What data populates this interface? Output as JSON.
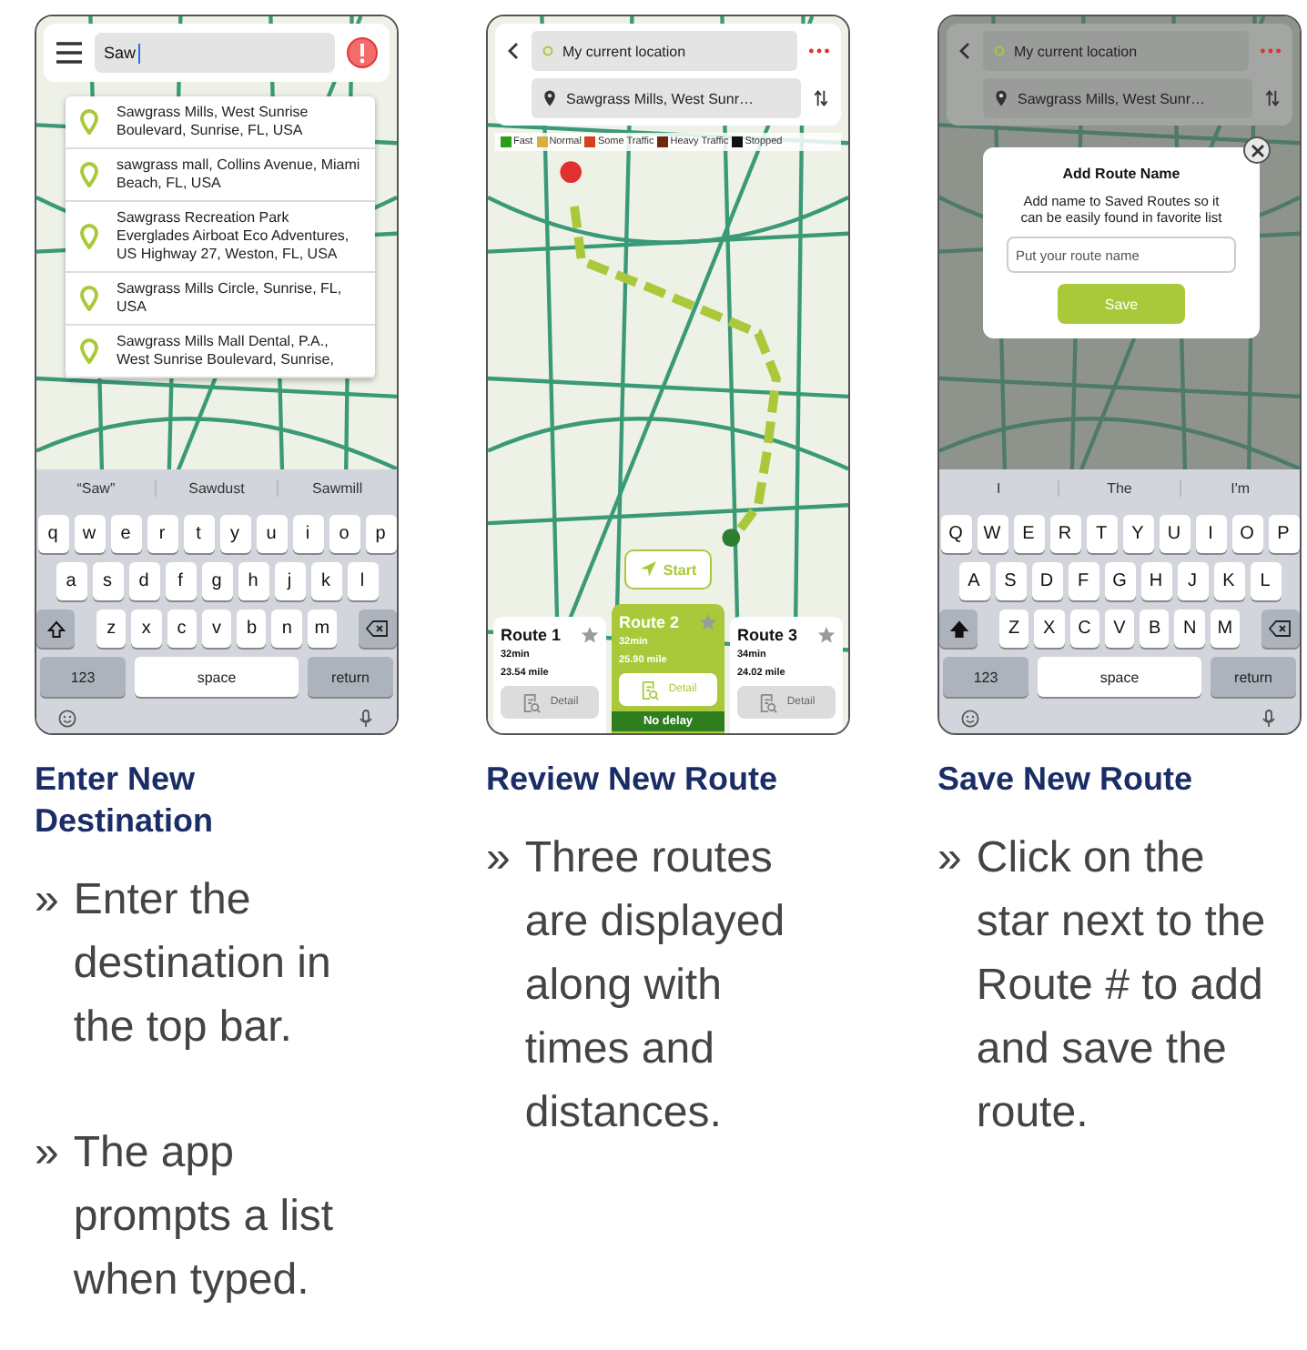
{
  "steps": [
    {
      "screen": {
        "kind": "search",
        "search": {
          "value": "Saw"
        },
        "suggestions": [
          {
            "text": "Sawgrass Mills, West Sunrise Boulevard, Sunrise, FL, USA"
          },
          {
            "text": "sawgrass mall, Collins Avenue, Miami Beach, FL, USA"
          },
          {
            "text": "Sawgrass Recreation Park Everglades Airboat Eco Adventures, US Highway 27, Weston, FL, USA"
          },
          {
            "text": "Sawgrass Mills Circle, Sunrise, FL, USA"
          },
          {
            "text": "Sawgrass Mills Mall Dental, P.A., West Sunrise Boulevard, Sunrise,"
          }
        ],
        "keyboard": {
          "suggestions": [
            "“Saw”",
            "Sawdust",
            "Sawmill"
          ],
          "rows": [
            [
              "q",
              "w",
              "e",
              "r",
              "t",
              "y",
              "u",
              "i",
              "o",
              "p"
            ],
            [
              "a",
              "s",
              "d",
              "f",
              "g",
              "h",
              "j",
              "k",
              "l"
            ],
            [
              "z",
              "x",
              "c",
              "v",
              "b",
              "n",
              "m"
            ]
          ],
          "shift_on": false,
          "numbers_key": "123",
          "space_key": "space",
          "return_key": "return"
        }
      },
      "heading": "Enter New Destination",
      "bullets": [
        {
          "marker": "»",
          "text": "Enter the destination in the top bar."
        },
        {
          "marker": "»",
          "text": "The app prompts a list when typed."
        }
      ]
    },
    {
      "screen": {
        "kind": "routes",
        "origin": "My current location",
        "destination": "Sawgrass Mills, West Sunr…",
        "legend": [
          {
            "label": "Fast",
            "color": "#2a9d1a"
          },
          {
            "label": "Normal",
            "color": "#d8b040"
          },
          {
            "label": "Some Traffic",
            "color": "#d2401c"
          },
          {
            "label": "Heavy Traffic",
            "color": "#6e2a0c"
          },
          {
            "label": "Stopped",
            "color": "#111111"
          }
        ],
        "start": "Start",
        "routes": [
          {
            "name": "Route 1",
            "time": "32min",
            "distance": "23.54 mile",
            "detail": "Detail",
            "selected": false
          },
          {
            "name": "Route 2",
            "time": "32min",
            "distance": "25.90 mile",
            "detail": "Detail",
            "selected": true,
            "badge": "No delay"
          },
          {
            "name": "Route 3",
            "time": "34min",
            "distance": "24.02 mile",
            "detail": "Detail",
            "selected": false
          }
        ]
      },
      "heading": "Review New Route",
      "bullets": [
        {
          "marker": "»",
          "text": "Three routes are displayed along with times and distances."
        }
      ]
    },
    {
      "screen": {
        "kind": "save",
        "origin": "My current location",
        "destination": "Sawgrass Mills, West Sunr…",
        "dialog": {
          "title": "Add Route Name",
          "message": "Add name to Saved Routes so it can be easily found in favorite list",
          "placeholder": "Put your route name",
          "button": "Save"
        },
        "keyboard": {
          "suggestions": [
            "I",
            "The",
            "I'm"
          ],
          "rows": [
            [
              "Q",
              "W",
              "E",
              "R",
              "T",
              "Y",
              "U",
              "I",
              "O",
              "P"
            ],
            [
              "A",
              "S",
              "D",
              "F",
              "G",
              "H",
              "J",
              "K",
              "L"
            ],
            [
              "Z",
              "X",
              "C",
              "V",
              "B",
              "N",
              "M"
            ]
          ],
          "shift_on": true,
          "numbers_key": "123",
          "space_key": "space",
          "return_key": "return"
        }
      },
      "heading": "Save New Route",
      "bullets": [
        {
          "marker": "»",
          "text": "Click on the star next to the Route # to add and save the route."
        }
      ]
    }
  ]
}
